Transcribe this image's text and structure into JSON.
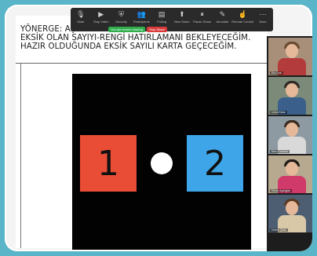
{
  "slide": {
    "instruction": "YÖNERGE: AŞAĞIDAKİ KARTLARI ... GÖSTERECEĞİM. KARTTA EKSİK OLAN SAYIYI-RENGİ HATIRLAMANI BEKLEYECEĞİM. HAZIR OLDUĞUNDA EKSİK SAYILI KARTA GEÇECEĞİM.",
    "cards": [
      {
        "value": "1",
        "color": "#e94d36"
      },
      {
        "value": "2",
        "color": "#3ea6e8"
      }
    ]
  },
  "toolbar": {
    "items": [
      {
        "label": "Mute",
        "icon": "microphone-icon"
      },
      {
        "label": "Stop Video",
        "icon": "video-camera-icon"
      },
      {
        "label": "Security",
        "icon": "shield-icon"
      },
      {
        "label": "Participants",
        "icon": "participants-icon"
      },
      {
        "label": "Polling",
        "icon": "poll-icon"
      },
      {
        "label": "New Share",
        "icon": "share-screen-icon"
      },
      {
        "label": "Pause Share",
        "icon": "pause-icon"
      },
      {
        "label": "Annotate",
        "icon": "pencil-icon"
      },
      {
        "label": "Remote Control",
        "icon": "remote-control-icon"
      },
      {
        "label": "More",
        "icon": "more-icon"
      }
    ],
    "sharing_status": "You are screen sharing",
    "stop_share": "Stop Share"
  },
  "gallery": {
    "participants": [
      {
        "name": "Ela Ural",
        "hair": "#6b4a33",
        "shirt": "#b33b3b",
        "bg": "#a88f7a"
      },
      {
        "name": "Umut Köse",
        "hair": "#2f2a24",
        "shirt": "#3a5f8a",
        "bg": "#7c8a7a"
      },
      {
        "name": "Ebru Yıldırım",
        "hair": "#3a2a20",
        "shirt": "#d9d9d9",
        "bg": "#8d9aa1"
      },
      {
        "name": "Deniz Aydoğdu",
        "hair": "#1f1a16",
        "shirt": "#cf3a6a",
        "bg": "#b7a98f"
      },
      {
        "name": "Defne Çelik",
        "hair": "#5a3a22",
        "shirt": "#d8c8a8",
        "bg": "#4d5e72"
      }
    ]
  }
}
